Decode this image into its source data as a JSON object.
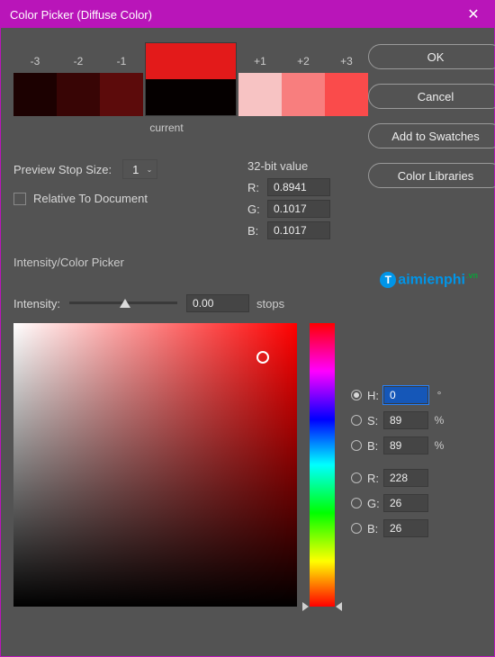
{
  "window": {
    "title": "Color Picker (Diffuse Color)"
  },
  "buttons": {
    "ok": "OK",
    "cancel": "Cancel",
    "add_swatches": "Add to Swatches",
    "color_libs": "Color Libraries"
  },
  "stops": {
    "labels": [
      "-3",
      "-2",
      "-1",
      "+1",
      "+2",
      "+3"
    ],
    "colors": [
      "#1c0101",
      "#380505",
      "#5c0b0b",
      "#f7c3c3",
      "#f87e7e",
      "#fa4b4b"
    ],
    "new_color": "#e31a1a",
    "current_color": "#050000",
    "current_label": "current"
  },
  "preview": {
    "label": "Preview Stop Size:",
    "value": "1",
    "relative_label": "Relative To Document",
    "relative_checked": false
  },
  "bit32": {
    "title": "32-bit value",
    "r_label": "R:",
    "r": "0.8941",
    "g_label": "G:",
    "g": "0.1017",
    "b_label": "B:",
    "b": "0.1017"
  },
  "section": {
    "intensity_picker": "Intensity/Color Picker"
  },
  "intensity": {
    "label": "Intensity:",
    "value": "0.00",
    "unit": "stops"
  },
  "hue_base": "#ff0000",
  "sv_cursor": {
    "x_pct": 88,
    "y_pct": 12
  },
  "hsb": {
    "h_label": "H:",
    "h": "0",
    "h_unit": "°",
    "s_label": "S:",
    "s": "89",
    "s_unit": "%",
    "b_label": "B:",
    "b": "89",
    "b_unit": "%",
    "r_label": "R:",
    "r": "228",
    "g_label": "G:",
    "g": "26",
    "bb_label": "B:",
    "bb": "26",
    "selected": "H"
  },
  "watermark": {
    "text": "aimienphi",
    "suffix": ".vn"
  }
}
